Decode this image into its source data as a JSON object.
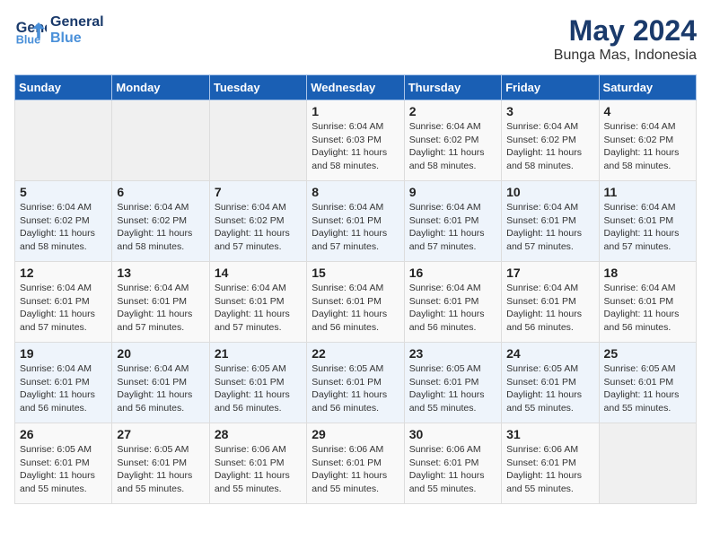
{
  "header": {
    "logo_line1": "General",
    "logo_line2": "Blue",
    "title": "May 2024",
    "subtitle": "Bunga Mas, Indonesia"
  },
  "weekdays": [
    "Sunday",
    "Monday",
    "Tuesday",
    "Wednesday",
    "Thursday",
    "Friday",
    "Saturday"
  ],
  "weeks": [
    [
      {
        "day": "",
        "info": ""
      },
      {
        "day": "",
        "info": ""
      },
      {
        "day": "",
        "info": ""
      },
      {
        "day": "1",
        "info": "Sunrise: 6:04 AM\nSunset: 6:03 PM\nDaylight: 11 hours\nand 58 minutes."
      },
      {
        "day": "2",
        "info": "Sunrise: 6:04 AM\nSunset: 6:02 PM\nDaylight: 11 hours\nand 58 minutes."
      },
      {
        "day": "3",
        "info": "Sunrise: 6:04 AM\nSunset: 6:02 PM\nDaylight: 11 hours\nand 58 minutes."
      },
      {
        "day": "4",
        "info": "Sunrise: 6:04 AM\nSunset: 6:02 PM\nDaylight: 11 hours\nand 58 minutes."
      }
    ],
    [
      {
        "day": "5",
        "info": "Sunrise: 6:04 AM\nSunset: 6:02 PM\nDaylight: 11 hours\nand 58 minutes."
      },
      {
        "day": "6",
        "info": "Sunrise: 6:04 AM\nSunset: 6:02 PM\nDaylight: 11 hours\nand 58 minutes."
      },
      {
        "day": "7",
        "info": "Sunrise: 6:04 AM\nSunset: 6:02 PM\nDaylight: 11 hours\nand 57 minutes."
      },
      {
        "day": "8",
        "info": "Sunrise: 6:04 AM\nSunset: 6:01 PM\nDaylight: 11 hours\nand 57 minutes."
      },
      {
        "day": "9",
        "info": "Sunrise: 6:04 AM\nSunset: 6:01 PM\nDaylight: 11 hours\nand 57 minutes."
      },
      {
        "day": "10",
        "info": "Sunrise: 6:04 AM\nSunset: 6:01 PM\nDaylight: 11 hours\nand 57 minutes."
      },
      {
        "day": "11",
        "info": "Sunrise: 6:04 AM\nSunset: 6:01 PM\nDaylight: 11 hours\nand 57 minutes."
      }
    ],
    [
      {
        "day": "12",
        "info": "Sunrise: 6:04 AM\nSunset: 6:01 PM\nDaylight: 11 hours\nand 57 minutes."
      },
      {
        "day": "13",
        "info": "Sunrise: 6:04 AM\nSunset: 6:01 PM\nDaylight: 11 hours\nand 57 minutes."
      },
      {
        "day": "14",
        "info": "Sunrise: 6:04 AM\nSunset: 6:01 PM\nDaylight: 11 hours\nand 57 minutes."
      },
      {
        "day": "15",
        "info": "Sunrise: 6:04 AM\nSunset: 6:01 PM\nDaylight: 11 hours\nand 56 minutes."
      },
      {
        "day": "16",
        "info": "Sunrise: 6:04 AM\nSunset: 6:01 PM\nDaylight: 11 hours\nand 56 minutes."
      },
      {
        "day": "17",
        "info": "Sunrise: 6:04 AM\nSunset: 6:01 PM\nDaylight: 11 hours\nand 56 minutes."
      },
      {
        "day": "18",
        "info": "Sunrise: 6:04 AM\nSunset: 6:01 PM\nDaylight: 11 hours\nand 56 minutes."
      }
    ],
    [
      {
        "day": "19",
        "info": "Sunrise: 6:04 AM\nSunset: 6:01 PM\nDaylight: 11 hours\nand 56 minutes."
      },
      {
        "day": "20",
        "info": "Sunrise: 6:04 AM\nSunset: 6:01 PM\nDaylight: 11 hours\nand 56 minutes."
      },
      {
        "day": "21",
        "info": "Sunrise: 6:05 AM\nSunset: 6:01 PM\nDaylight: 11 hours\nand 56 minutes."
      },
      {
        "day": "22",
        "info": "Sunrise: 6:05 AM\nSunset: 6:01 PM\nDaylight: 11 hours\nand 56 minutes."
      },
      {
        "day": "23",
        "info": "Sunrise: 6:05 AM\nSunset: 6:01 PM\nDaylight: 11 hours\nand 55 minutes."
      },
      {
        "day": "24",
        "info": "Sunrise: 6:05 AM\nSunset: 6:01 PM\nDaylight: 11 hours\nand 55 minutes."
      },
      {
        "day": "25",
        "info": "Sunrise: 6:05 AM\nSunset: 6:01 PM\nDaylight: 11 hours\nand 55 minutes."
      }
    ],
    [
      {
        "day": "26",
        "info": "Sunrise: 6:05 AM\nSunset: 6:01 PM\nDaylight: 11 hours\nand 55 minutes."
      },
      {
        "day": "27",
        "info": "Sunrise: 6:05 AM\nSunset: 6:01 PM\nDaylight: 11 hours\nand 55 minutes."
      },
      {
        "day": "28",
        "info": "Sunrise: 6:06 AM\nSunset: 6:01 PM\nDaylight: 11 hours\nand 55 minutes."
      },
      {
        "day": "29",
        "info": "Sunrise: 6:06 AM\nSunset: 6:01 PM\nDaylight: 11 hours\nand 55 minutes."
      },
      {
        "day": "30",
        "info": "Sunrise: 6:06 AM\nSunset: 6:01 PM\nDaylight: 11 hours\nand 55 minutes."
      },
      {
        "day": "31",
        "info": "Sunrise: 6:06 AM\nSunset: 6:01 PM\nDaylight: 11 hours\nand 55 minutes."
      },
      {
        "day": "",
        "info": ""
      }
    ]
  ]
}
